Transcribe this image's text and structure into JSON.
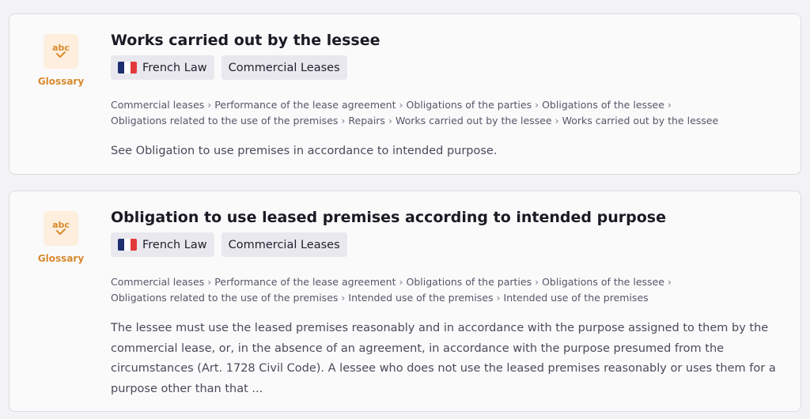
{
  "results": [
    {
      "type_label": "Glossary",
      "type_icon": "abc-glossary-icon",
      "title": "Works carried out by the lessee",
      "tags": [
        {
          "label": "French Law",
          "icon": "french-flag-icon"
        },
        {
          "label": "Commercial Leases"
        }
      ],
      "breadcrumb": {
        "line1": [
          "Commercial leases",
          "Performance of the lease agreement",
          "Obligations of the parties",
          "Obligations of the lessee"
        ],
        "line2": [
          "Obligations related to the use of the premises",
          "Repairs",
          "Works carried out by the lessee",
          "Works carried out by the lessee"
        ]
      },
      "excerpt": "See Obligation to use premises in accordance to intended purpose."
    },
    {
      "type_label": "Glossary",
      "type_icon": "abc-glossary-icon",
      "title": "Obligation to use leased premises according to intended purpose",
      "tags": [
        {
          "label": "French Law",
          "icon": "french-flag-icon"
        },
        {
          "label": "Commercial Leases"
        }
      ],
      "breadcrumb": {
        "line1": [
          "Commercial leases",
          "Performance of the lease agreement",
          "Obligations of the parties",
          "Obligations of the lessee"
        ],
        "line2": [
          "Obligations related to the use of the premises",
          "Intended use of the premises",
          "Intended use of the premises"
        ]
      },
      "excerpt": "The lessee must use the leased premises reasonably and in accordance with the purpose assigned to them by the commercial lease, or, in the absence of an agreement, in accordance with the purpose presumed from the circumstances (Art. 1728 Civil Code). A lessee who does not use the leased premises reasonably or uses them for a purpose other than that ..."
    }
  ],
  "breadcrumb_separator": "›",
  "colors": {
    "accent": "#d98a2e",
    "icon_bg": "#fdeedd",
    "tag_bg": "#e8e8ee",
    "card_bg": "#fafafb",
    "flag_blue": "#1f2e6e",
    "flag_red": "#e23a3a"
  }
}
